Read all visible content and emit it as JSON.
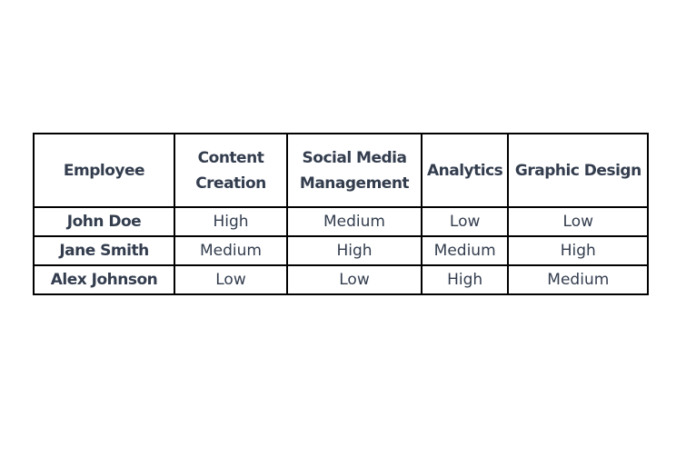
{
  "table": {
    "headers": [
      "Employee",
      "Content Creation",
      "Social Media Management",
      "Analytics",
      "Graphic Design"
    ],
    "rows": [
      [
        "John Doe",
        "High",
        "Medium",
        "Low",
        "Low"
      ],
      [
        "Jane Smith",
        "Medium",
        "High",
        "Medium",
        "High"
      ],
      [
        "Alex Johnson",
        "Low",
        "Low",
        "High",
        "Medium"
      ]
    ]
  }
}
